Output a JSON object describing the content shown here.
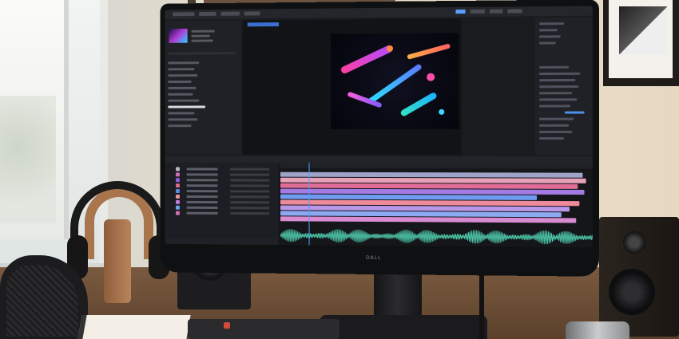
{
  "scene": {
    "description_free": true,
    "monitor_brand": "DALL"
  },
  "colors": {
    "ui_bg": "#1a1b1f",
    "accent": "#4ea0ff",
    "layer_colors": [
      "#b9b9c7",
      "#d46ab4",
      "#8f5fd8",
      "#e66b8a",
      "#5d8ee6",
      "#e89aa2",
      "#c57be0",
      "#6aa3f0",
      "#d66fb0"
    ],
    "track_colors": [
      "#9ea3c8",
      "#e6a0b8",
      "#e06d98",
      "#a47ae3",
      "#6f9bf0",
      "#ee8a9a",
      "#b896e8",
      "#8da9f2",
      "#d98bd2"
    ],
    "audio": "#53d7b5"
  },
  "icons": [
    "headphones-icon",
    "speaker-icon",
    "keyboard-icon",
    "notebook-icon",
    "mug-icon"
  ]
}
